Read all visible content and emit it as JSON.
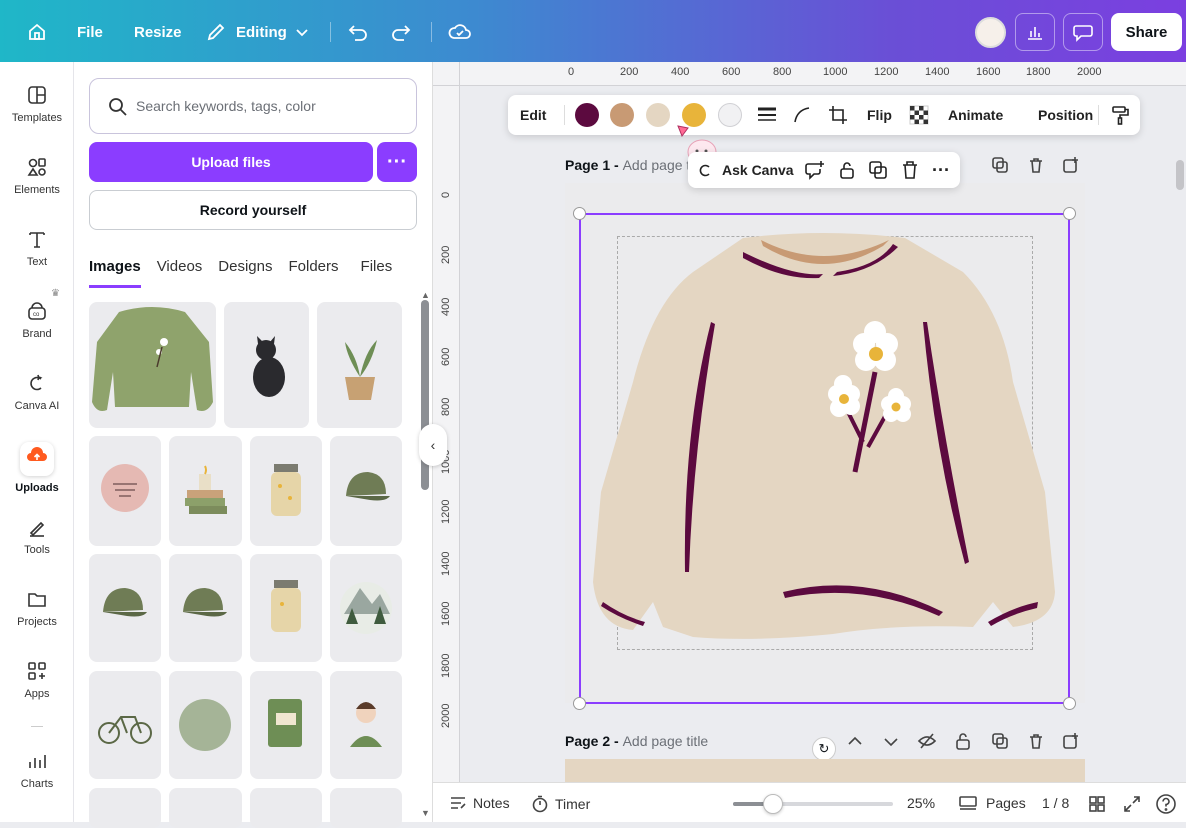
{
  "topbar": {
    "file": "File",
    "resize": "Resize",
    "editing": "Editing",
    "share": "Share"
  },
  "rail": {
    "items": [
      {
        "label": "Templates",
        "icon": "templates-icon"
      },
      {
        "label": "Elements",
        "icon": "elements-icon"
      },
      {
        "label": "Text",
        "icon": "text-icon"
      },
      {
        "label": "Brand",
        "icon": "brand-icon"
      },
      {
        "label": "Canva AI",
        "icon": "canva-ai-icon"
      },
      {
        "label": "Uploads",
        "icon": "uploads-icon"
      },
      {
        "label": "Tools",
        "icon": "tools-icon"
      },
      {
        "label": "Projects",
        "icon": "projects-icon"
      },
      {
        "label": "Apps",
        "icon": "apps-icon"
      },
      {
        "label": "Charts",
        "icon": "charts-icon"
      }
    ]
  },
  "panel": {
    "search_placeholder": "Search keywords, tags, color",
    "upload_label": "Upload files",
    "record_label": "Record yourself",
    "tabs": [
      "Images",
      "Videos",
      "Designs",
      "Folders",
      "Files"
    ],
    "active_tab": "Images"
  },
  "rulers": {
    "top": [
      "0",
      "200",
      "400",
      "600",
      "800",
      "1000",
      "1200",
      "1400",
      "1600",
      "1800",
      "2000"
    ],
    "left": [
      "0",
      "200",
      "400",
      "600",
      "800",
      "1000",
      "1200",
      "1400",
      "1600",
      "1800",
      "2000"
    ]
  },
  "context_toolbar": {
    "edit": "Edit",
    "colors": [
      "#5c0a3f",
      "#c89a74",
      "#e4d6c2",
      "#e8b43a",
      "#f1f1f3"
    ],
    "flip": "Flip",
    "animate": "Animate",
    "position": "Position"
  },
  "ask_canva": {
    "label": "Ask Canva"
  },
  "pages": {
    "page1_prefix": "Page 1 - ",
    "page1_title_placeholder": "Add page title",
    "page2_prefix": "Page 2 - ",
    "page2_title_placeholder": "Add page title"
  },
  "bottombar": {
    "notes": "Notes",
    "timer": "Timer",
    "zoom": "25%",
    "zoom_level": 0.25,
    "pages": "Pages",
    "page_count": "1 / 8"
  }
}
